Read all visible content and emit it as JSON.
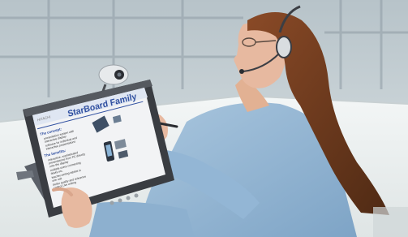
{
  "photo": {
    "screen": {
      "brand": "HITACHI",
      "title": "StarBoard Family",
      "sections": [
        {
          "heading": "The concept:",
          "bullets": [
            "presentation system with",
            "interactive display",
            "software for individual and",
            "interactive presentations"
          ]
        },
        {
          "heading": "The benefits:",
          "bullets": [
            "interactive, sophisticated",
            "presentations from PC directly",
            "onto the display",
            "multiple users connecting",
            "desks etc.",
            "teacher-writing tablets in",
            "one unit",
            "better quality and reference",
            "control Live writing"
          ]
        }
      ]
    },
    "colors": {
      "wall": "#c9d3d8",
      "window_frame": "#8f9ca5",
      "desk": "#e9eeee",
      "hair": "#6b3a1f",
      "shirt": "#8fb4d4",
      "skin": "#e7b9a0",
      "monitor_bezel": "#3a3d42",
      "screen_bg": "#f2f3f5",
      "title_blue": "#2f4fa0"
    }
  }
}
